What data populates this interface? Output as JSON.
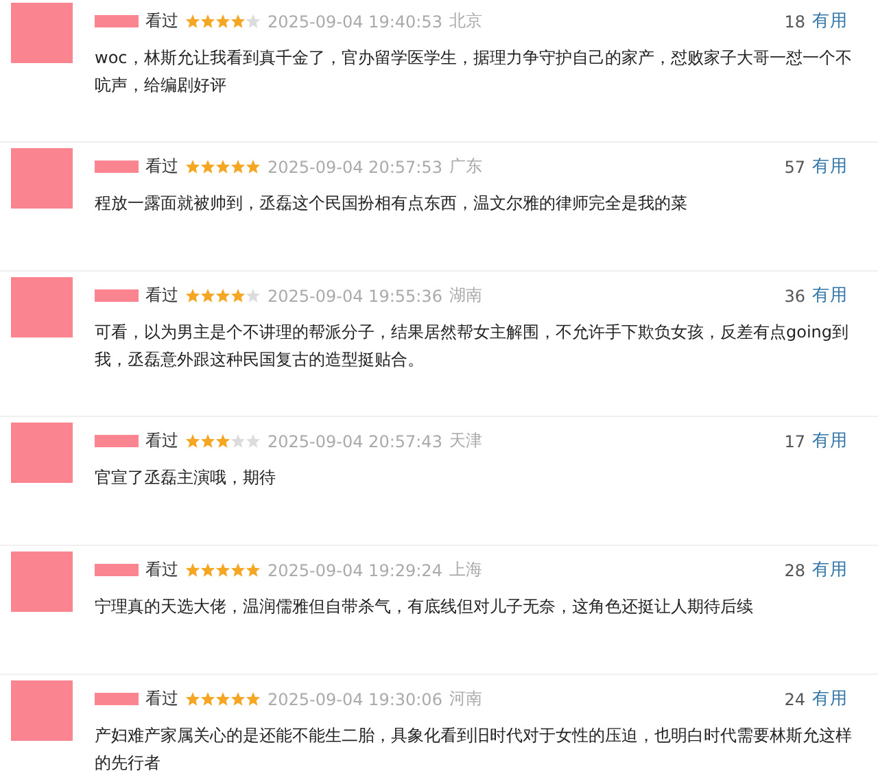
{
  "comments": [
    {
      "status": "看过",
      "stars": 4,
      "time": "2025-09-04 19:40:53",
      "location": "北京",
      "votes": "18",
      "useful": "有用",
      "text": "woc，林斯允让我看到真千金了，官办留学医学生，据理力争守护自己的家产，怼败家子大哥一怼一个不吭声，给编剧好评"
    },
    {
      "status": "看过",
      "stars": 5,
      "time": "2025-09-04 20:57:53",
      "location": "广东",
      "votes": "57",
      "useful": "有用",
      "text": "程放一露面就被帅到，丞磊这个民国扮相有点东西，温文尔雅的律师完全是我的菜"
    },
    {
      "status": "看过",
      "stars": 4,
      "time": "2025-09-04 19:55:36",
      "location": "湖南",
      "votes": "36",
      "useful": "有用",
      "text": "可看，以为男主是个不讲理的帮派分子，结果居然帮女主解围，不允许手下欺负女孩，反差有点going到我，丞磊意外跟这种民国复古的造型挺贴合。"
    },
    {
      "status": "看过",
      "stars": 3,
      "time": "2025-09-04 20:57:43",
      "location": "天津",
      "votes": "17",
      "useful": "有用",
      "text": "官宣了丞磊主演哦，期待"
    },
    {
      "status": "看过",
      "stars": 5,
      "time": "2025-09-04 19:29:24",
      "location": "上海",
      "votes": "28",
      "useful": "有用",
      "text": "宁理真的天选大佬，温润儒雅但自带杀气，有底线但对儿子无奈，这角色还挺让人期待后续"
    },
    {
      "status": "看过",
      "stars": 5,
      "time": "2025-09-04 19:30:06",
      "location": "河南",
      "votes": "24",
      "useful": "有用",
      "text": "产妇难产家属关心的是还能不能生二胎，具象化看到旧时代对于女性的压迫，也明白时代需要林斯允这样的先行者"
    }
  ]
}
